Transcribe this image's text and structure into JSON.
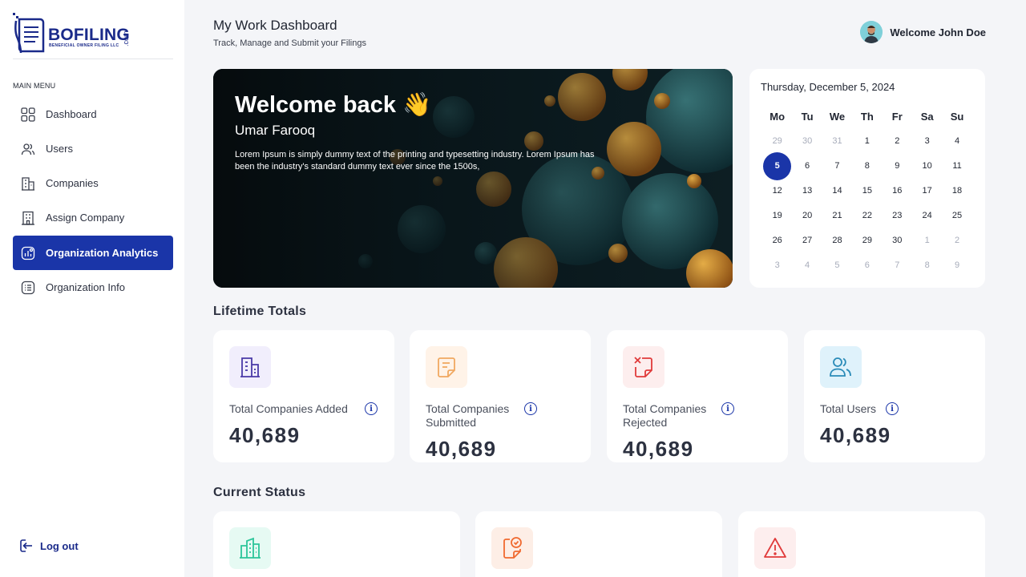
{
  "brand": {
    "name": "BOFILING",
    "suffix": ".com",
    "tagline": "BENEFICIAL OWNER FILING LLC"
  },
  "sidebar": {
    "menu_title": "MAIN MENU",
    "items": [
      {
        "label": "Dashboard",
        "icon": "grid-icon"
      },
      {
        "label": "Users",
        "icon": "users-icon"
      },
      {
        "label": "Companies",
        "icon": "building-icon"
      },
      {
        "label": "Assign Company",
        "icon": "office-icon"
      },
      {
        "label": "Organization Analytics",
        "icon": "analytics-icon",
        "active": true
      },
      {
        "label": "Organization Info",
        "icon": "list-icon"
      }
    ],
    "logout_label": "Log out",
    "active_color": "#1a35a8"
  },
  "header": {
    "title": "My Work Dashboard",
    "subtitle": "Track, Manage and Submit your Filings",
    "welcome": "Welcome John Doe"
  },
  "banner": {
    "title": "Welcome back 👋",
    "name": "Umar Farooq",
    "text": "Lorem Ipsum is simply dummy text of the printing and typesetting industry. Lorem Ipsum has been the industry's standard dummy text ever since the 1500s,"
  },
  "calendar": {
    "date_label": "Thursday, December 5, 2024",
    "weekdays": [
      "Mo",
      "Tu",
      "We",
      "Th",
      "Fr",
      "Sa",
      "Su"
    ],
    "weeks": [
      [
        "29",
        "30",
        "31",
        "1",
        "2",
        "3",
        "4"
      ],
      [
        "5",
        "6",
        "7",
        "8",
        "9",
        "10",
        "11"
      ],
      [
        "12",
        "13",
        "14",
        "15",
        "16",
        "17",
        "18"
      ],
      [
        "19",
        "20",
        "21",
        "22",
        "23",
        "24",
        "25"
      ],
      [
        "26",
        "27",
        "28",
        "29",
        "30",
        "1",
        "2"
      ],
      [
        "3",
        "4",
        "5",
        "6",
        "7",
        "8",
        "9"
      ]
    ],
    "selected": "5"
  },
  "lifetime": {
    "title": "Lifetime Totals",
    "cards": [
      {
        "label": "Total Companies Added",
        "value": "40,689",
        "icon": "building-icon",
        "bg": "#f1eefc",
        "color": "#4a3aa8"
      },
      {
        "label": "Total Companies Submitted",
        "value": "40,689",
        "icon": "document-icon",
        "bg": "#fff3e8",
        "color": "#f0a860"
      },
      {
        "label": "Total Companies Rejected",
        "value": "40,689",
        "icon": "rejected-document-icon",
        "bg": "#fdeeee",
        "color": "#e03a3a"
      },
      {
        "label": "Total Users",
        "value": "40,689",
        "icon": "users-icon",
        "bg": "#dff2fb",
        "color": "#2a8bb8"
      }
    ]
  },
  "current_status": {
    "title": "Current Status",
    "cards": [
      {
        "icon": "buildings-icon",
        "bg": "#e6faf3",
        "color": "#2cc59a"
      },
      {
        "icon": "approved-document-icon",
        "bg": "#fdeee6",
        "color": "#f06a30"
      },
      {
        "icon": "warning-icon",
        "bg": "#fdeeee",
        "color": "#e03a3a"
      }
    ]
  }
}
